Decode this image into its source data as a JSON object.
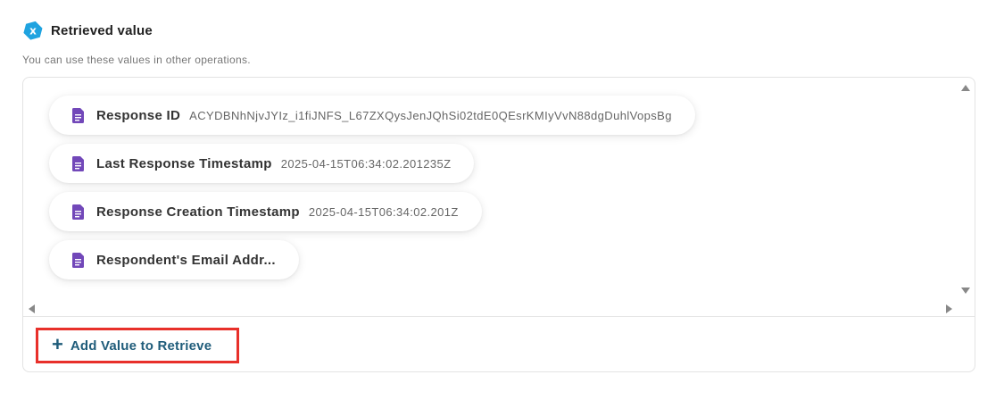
{
  "section": {
    "title": "Retrieved value",
    "subtitle": "You can use these values in other operations.",
    "icon": "variable-hex-icon",
    "icon_color": "#1fa3e0"
  },
  "values": [
    {
      "label": "Response ID",
      "value": "ACYDBNhNjvJYIz_i1fiJNFS_L67ZXQysJenJQhSi02tdE0QEsrKMIyVvN88dgDuhlVopsBg"
    },
    {
      "label": "Last Response Timestamp",
      "value": "2025-04-15T06:34:02.201235Z"
    },
    {
      "label": "Response Creation Timestamp",
      "value": "2025-04-15T06:34:02.201Z"
    },
    {
      "label": "Respondent's Email Addr...",
      "value": ""
    }
  ],
  "value_icon": "google-forms-doc-icon",
  "value_icon_color": "#7248b9",
  "add_button": {
    "label": "Add Value to Retrieve",
    "icon": "plus-icon",
    "color": "#1f5c7a",
    "highlight_color": "#e8302a"
  }
}
